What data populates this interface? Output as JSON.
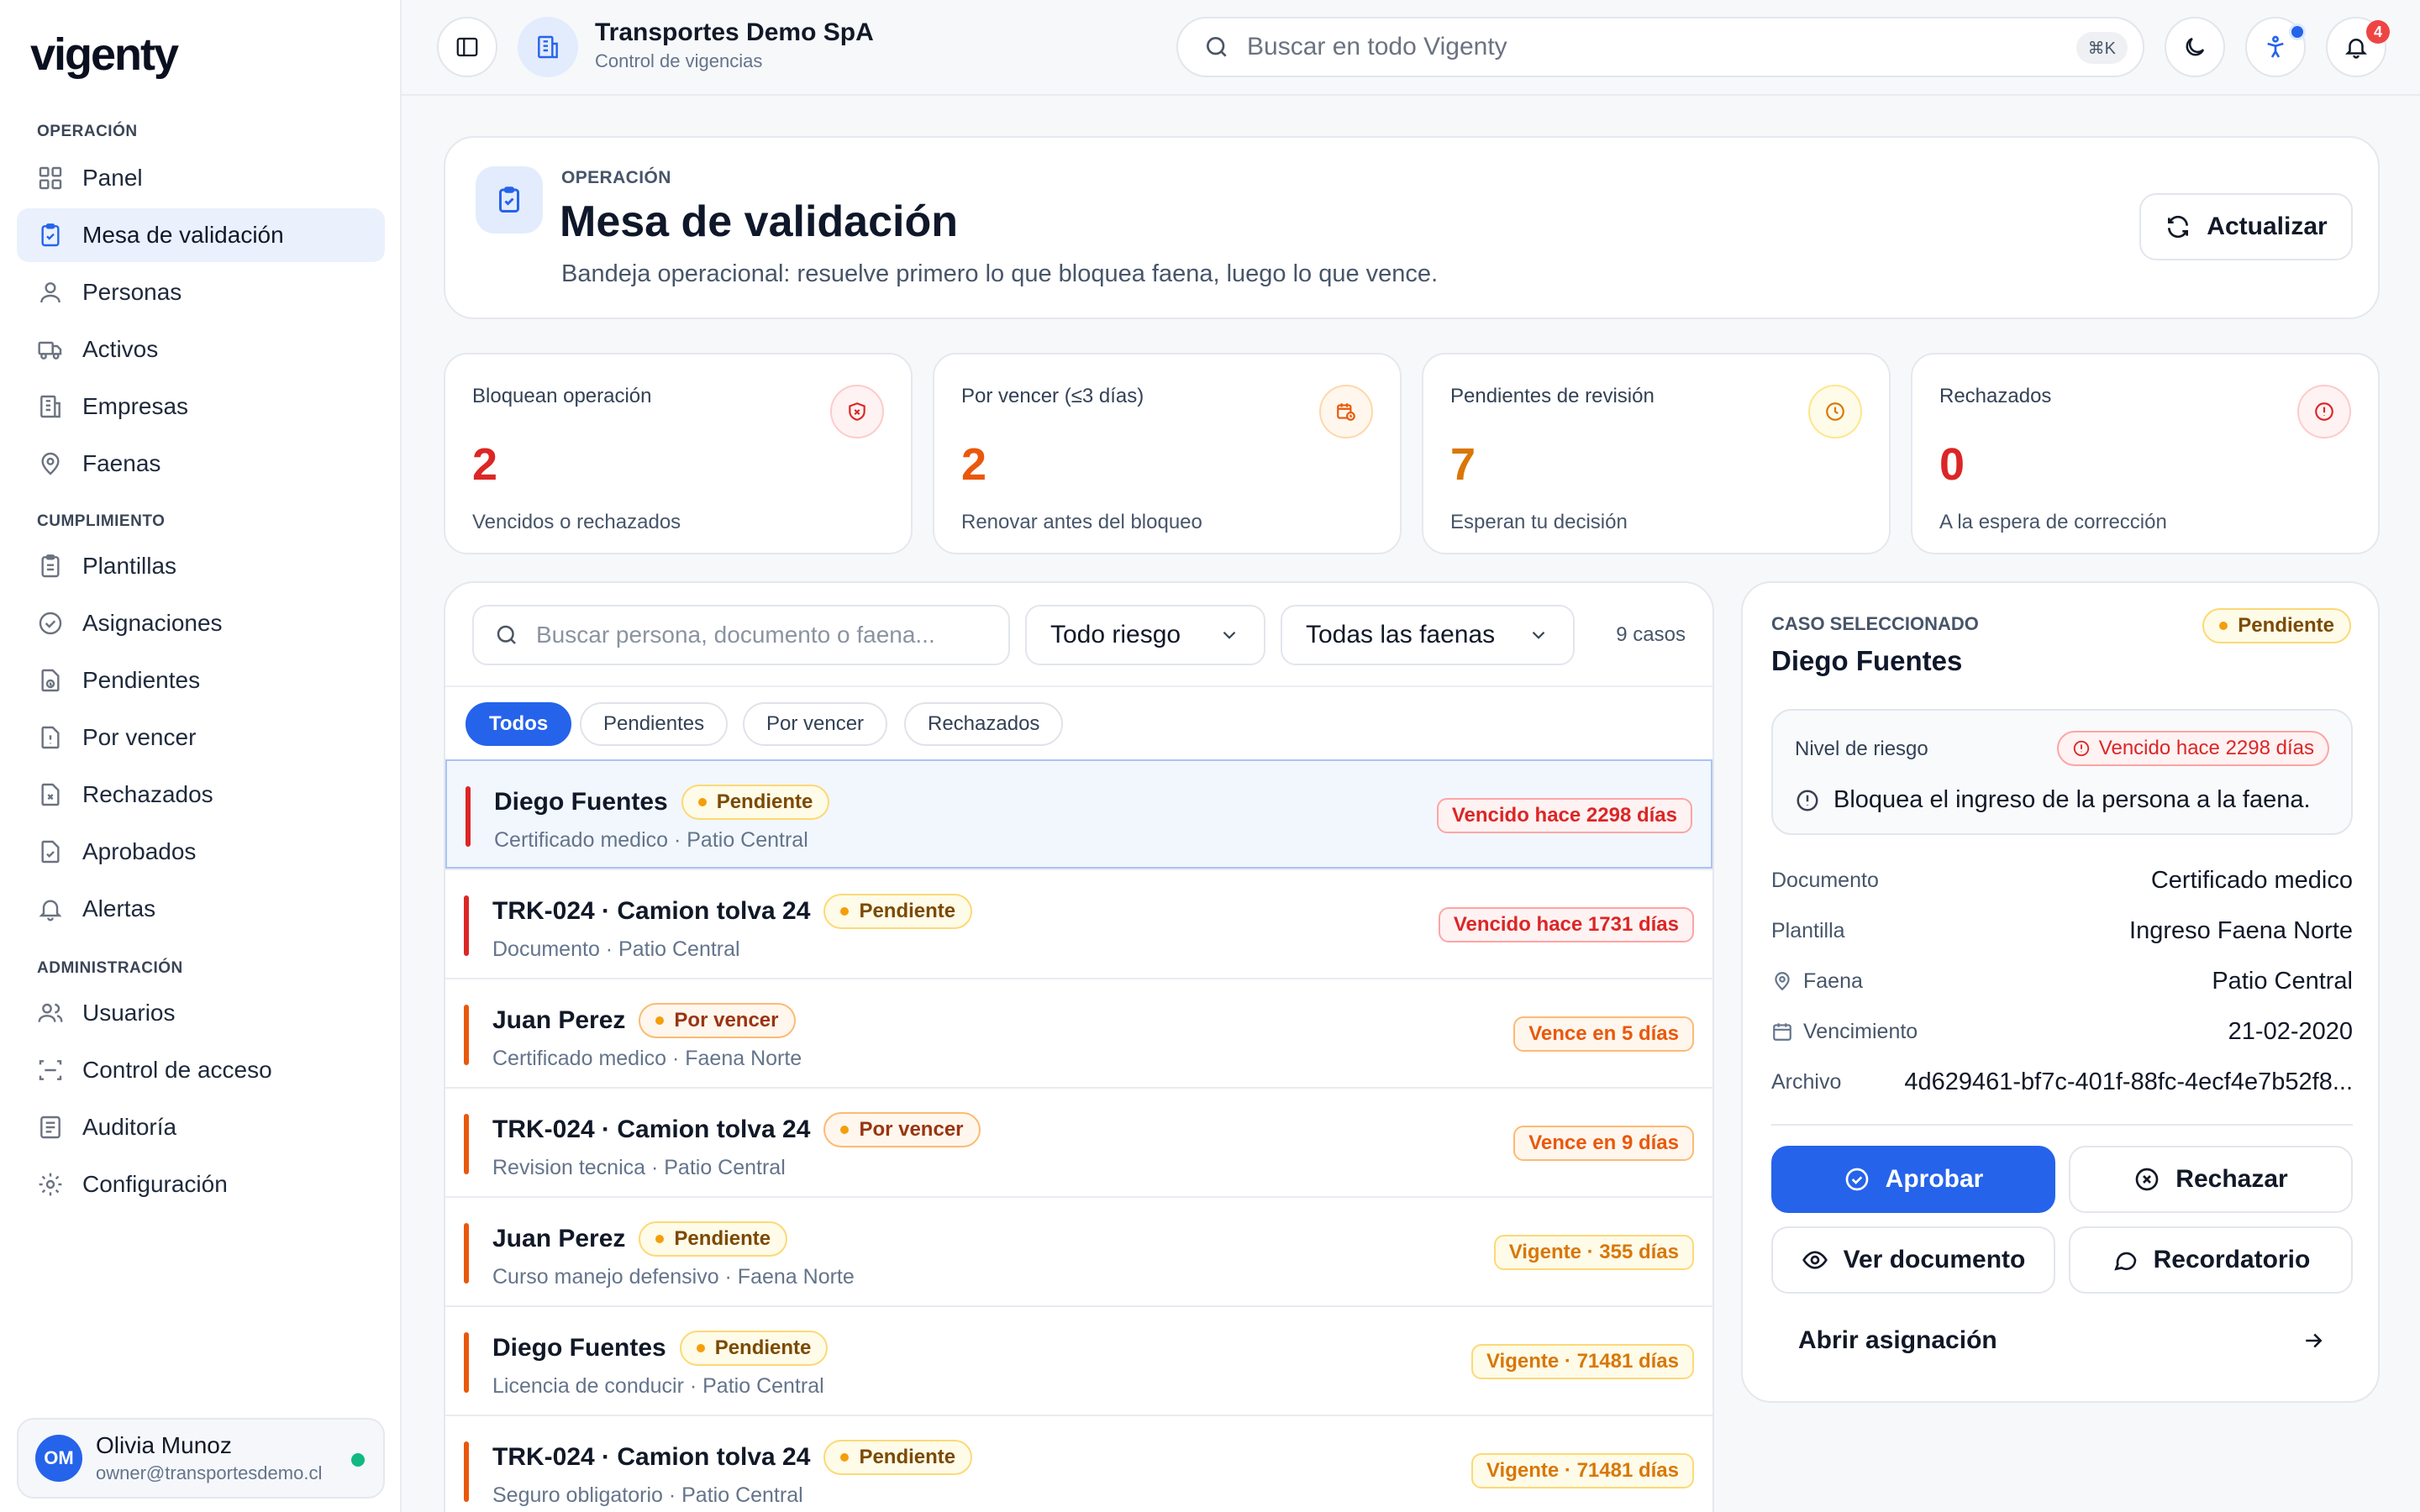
{
  "app": {
    "logo": "vigenty"
  },
  "sidebar": {
    "sections": [
      {
        "title": "OPERACIÓN",
        "items": [
          {
            "label": "Panel",
            "icon": "grid-icon"
          },
          {
            "label": "Mesa de validación",
            "icon": "clipboard-check-icon",
            "active": true
          },
          {
            "label": "Personas",
            "icon": "user-icon"
          },
          {
            "label": "Activos",
            "icon": "truck-icon"
          },
          {
            "label": "Empresas",
            "icon": "building-icon"
          },
          {
            "label": "Faenas",
            "icon": "map-pin-icon"
          }
        ]
      },
      {
        "title": "CUMPLIMIENTO",
        "items": [
          {
            "label": "Plantillas",
            "icon": "clipboard-list-icon"
          },
          {
            "label": "Asignaciones",
            "icon": "check-circle-icon"
          },
          {
            "label": "Pendientes",
            "icon": "file-clock-icon"
          },
          {
            "label": "Por vencer",
            "icon": "file-alert-icon"
          },
          {
            "label": "Rechazados",
            "icon": "file-x-icon"
          },
          {
            "label": "Aprobados",
            "icon": "file-check-icon"
          },
          {
            "label": "Alertas",
            "icon": "bell-icon"
          }
        ]
      },
      {
        "title": "ADMINISTRACIÓN",
        "items": [
          {
            "label": "Usuarios",
            "icon": "users-icon"
          },
          {
            "label": "Control de acceso",
            "icon": "scan-icon"
          },
          {
            "label": "Auditoría",
            "icon": "list-icon"
          },
          {
            "label": "Configuración",
            "icon": "gear-icon"
          }
        ]
      }
    ],
    "user": {
      "initials": "OM",
      "name": "Olivia Munoz",
      "email": "owner@transportesdemo.cl",
      "status_color": "#10b981"
    }
  },
  "topbar": {
    "org_name": "Transportes Demo SpA",
    "org_sub": "Control de vigencias",
    "search_placeholder": "Buscar en todo Vigenty",
    "search_shortcut": "⌘K",
    "notifications_count": "4"
  },
  "header": {
    "eyebrow": "OPERACIÓN",
    "title": "Mesa de validación",
    "subtitle": "Bandeja operacional: resuelve primero lo que bloquea faena, luego lo que vence.",
    "refresh_label": "Actualizar"
  },
  "stats": [
    {
      "label": "Bloquean operación",
      "value": "2",
      "desc": "Vencidos o rechazados",
      "color": "#dc2626",
      "icon": "shield-x-icon"
    },
    {
      "label": "Por vencer (≤3 días)",
      "value": "2",
      "desc": "Renovar antes del bloqueo",
      "color": "#ea580c",
      "icon": "calendar-clock-icon"
    },
    {
      "label": "Pendientes de revisión",
      "value": "7",
      "desc": "Esperan tu decisión",
      "color": "#d97706",
      "icon": "clock-icon"
    },
    {
      "label": "Rechazados",
      "value": "0",
      "desc": "A la espera de corrección",
      "color": "#dc2626",
      "icon": "alert-circle-icon"
    }
  ],
  "list": {
    "search_placeholder": "Buscar persona, documento o faena...",
    "risk_filter": "Todo riesgo",
    "site_filter": "Todas las faenas",
    "count": "9 casos",
    "tabs": [
      "Todos",
      "Pendientes",
      "Por vencer",
      "Rechazados"
    ],
    "rows": [
      {
        "title": "Diego Fuentes",
        "badge": "Pendiente",
        "sub": "Certificado medico · Patio Central",
        "status": "Vencido hace 2298 días",
        "tone": "red"
      },
      {
        "title": "TRK-024 · Camion tolva 24",
        "badge": "Pendiente",
        "sub": "Documento · Patio Central",
        "status": "Vencido hace 1731 días",
        "tone": "red"
      },
      {
        "title": "Juan Perez",
        "badge": "Por vencer",
        "sub": "Certificado medico · Faena Norte",
        "status": "Vence en 5 días",
        "tone": "orange"
      },
      {
        "title": "TRK-024 · Camion tolva 24",
        "badge": "Por vencer",
        "sub": "Revision tecnica · Patio Central",
        "status": "Vence en 9 días",
        "tone": "orange"
      },
      {
        "title": "Juan Perez",
        "badge": "Pendiente",
        "sub": "Curso manejo defensivo · Faena Norte",
        "status": "Vigente · 355 días",
        "tone": "yellow"
      },
      {
        "title": "Diego Fuentes",
        "badge": "Pendiente",
        "sub": "Licencia de conducir · Patio Central",
        "status": "Vigente · 71481 días",
        "tone": "yellow"
      },
      {
        "title": "TRK-024 · Camion tolva 24",
        "badge": "Pendiente",
        "sub": "Seguro obligatorio · Patio Central",
        "status": "Vigente · 71481 días",
        "tone": "yellow"
      }
    ]
  },
  "detail": {
    "eyebrow": "CASO SELECCIONADO",
    "name": "Diego Fuentes",
    "status": "Pendiente",
    "risk_label": "Nivel de riesgo",
    "risk_tag": "Vencido hace 2298 días",
    "risk_message": "Bloquea el ingreso de la persona a la faena.",
    "fields": [
      {
        "k": "Documento",
        "v": "Certificado medico"
      },
      {
        "k": "Plantilla",
        "v": "Ingreso Faena Norte"
      },
      {
        "k": "Faena",
        "v": "Patio Central",
        "icon": "map-pin-icon"
      },
      {
        "k": "Vencimiento",
        "v": "21-02-2020",
        "icon": "calendar-icon"
      },
      {
        "k": "Archivo",
        "v": "4d629461-bf7c-401f-88fc-4ecf4e7b52f8..."
      }
    ],
    "approve": "Aprobar",
    "reject": "Rechazar",
    "view_doc": "Ver documento",
    "reminder": "Recordatorio",
    "open_assignment": "Abrir asignación"
  }
}
